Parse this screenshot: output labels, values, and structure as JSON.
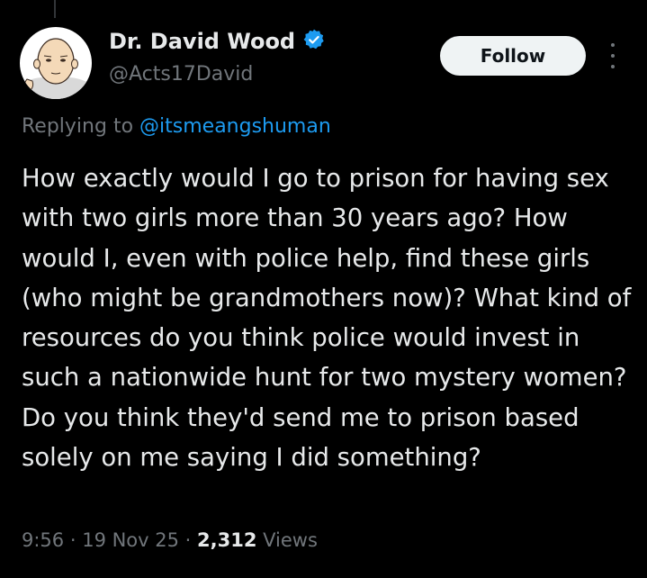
{
  "author": {
    "name": "Dr. David Wood",
    "handle": "@Acts17David",
    "verified": true
  },
  "follow_label": "Follow",
  "reply": {
    "prefix": "Replying to ",
    "mention": "@itsmeangshuman"
  },
  "tweet_text": "How exactly would I go to prison for having sex with two girls more than 30 years ago? How would I, even with police help, find these girls (who might be grandmothers now)? What kind of resources do you think police would invest in such a nationwide hunt for two mystery women? Do you think they'd send me to prison based solely on me saying I did something?",
  "meta": {
    "time": "9:56",
    "sep": " · ",
    "date": "19 Nov 25",
    "views_count": "2,312",
    "views_label": " Views"
  },
  "colors": {
    "background": "#000000",
    "text": "#e7e9ea",
    "secondary": "#71767b",
    "accent": "#1d9bf0",
    "follow_bg": "#eff3f4"
  },
  "icons": {
    "verified": "verified-badge-icon",
    "more": "more-options-icon"
  }
}
